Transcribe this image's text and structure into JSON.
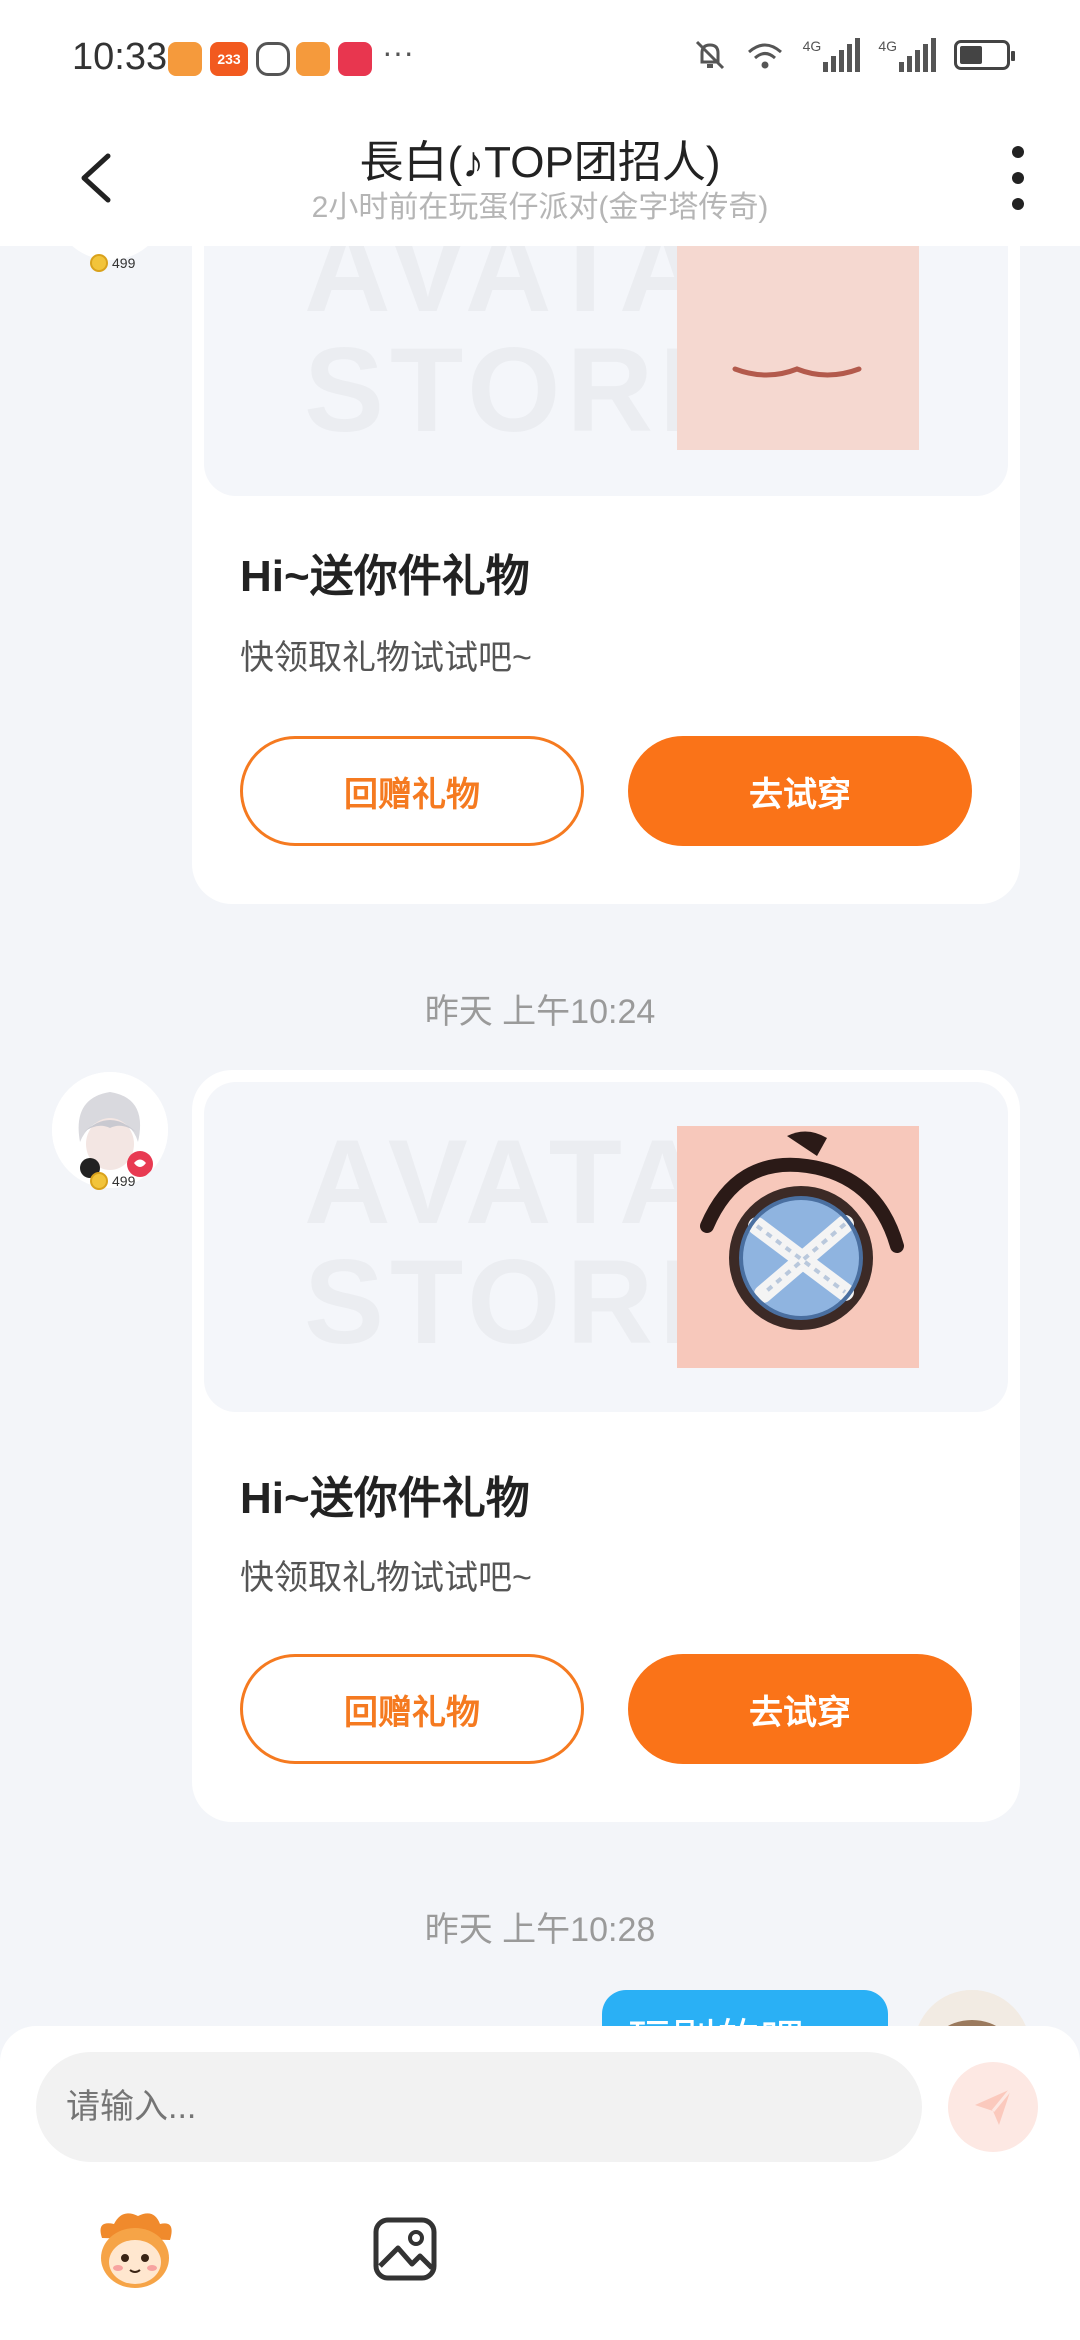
{
  "status_bar": {
    "time": "10:33",
    "notif_badge": "233",
    "notif_more": "···",
    "network_label_1": "4G",
    "network_label_2": "4G"
  },
  "header": {
    "title": "長白(♪TOP团招人)",
    "subtitle": "2小时前在玩蛋仔派对(金字塔传奇)"
  },
  "messages": [
    {
      "avatar_level": "499",
      "card_title": "Hi~送你件礼物",
      "card_desc": "快领取礼物试试吧~",
      "button_return": "回赠礼物",
      "button_try": "去试穿",
      "watermark": "AVATAR STORE"
    },
    {
      "timestamp": "昨天 上午10:24"
    },
    {
      "avatar_level": "499",
      "card_title": "Hi~送你件礼物",
      "card_desc": "快领取礼物试试吧~",
      "button_return": "回赠礼物",
      "button_try": "去试穿",
      "watermark": "AVATAR STORE"
    },
    {
      "timestamp": "昨天 上午10:28"
    },
    {
      "my_message": "玩别的吧"
    }
  ],
  "input": {
    "placeholder": "请输入..."
  },
  "colors": {
    "accent": "#fa7318",
    "bubble": "#2ab0f5",
    "background": "#f3f5f9"
  }
}
